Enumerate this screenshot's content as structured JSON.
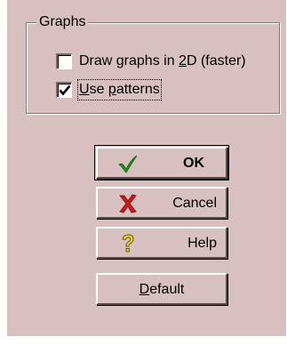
{
  "graphs_group": {
    "title": "Graphs",
    "draw_2d": {
      "label_before": "Draw graphs in ",
      "label_mnemonic": "2",
      "label_after": "D (faster)",
      "checked": false
    },
    "use_patterns": {
      "label_before": "",
      "label_mnemonic": "U",
      "label_mid": "se ",
      "label_mnemonic2": "p",
      "label_after": "atterns",
      "checked": true
    }
  },
  "buttons": {
    "ok": {
      "label": "OK",
      "icon": "green-checkmark-icon"
    },
    "cancel": {
      "label": "Cancel",
      "icon": "red-x-icon"
    },
    "help": {
      "label": "Help",
      "icon": "yellow-question-mark-icon"
    },
    "default": {
      "label_mnemonic": "D",
      "label_rest": "efault"
    }
  },
  "colors": {
    "dialog_background": "#d8c0c0",
    "check_green": "#1a9a1a",
    "cancel_red": "#d01818",
    "help_yellow": "#e8d820"
  }
}
